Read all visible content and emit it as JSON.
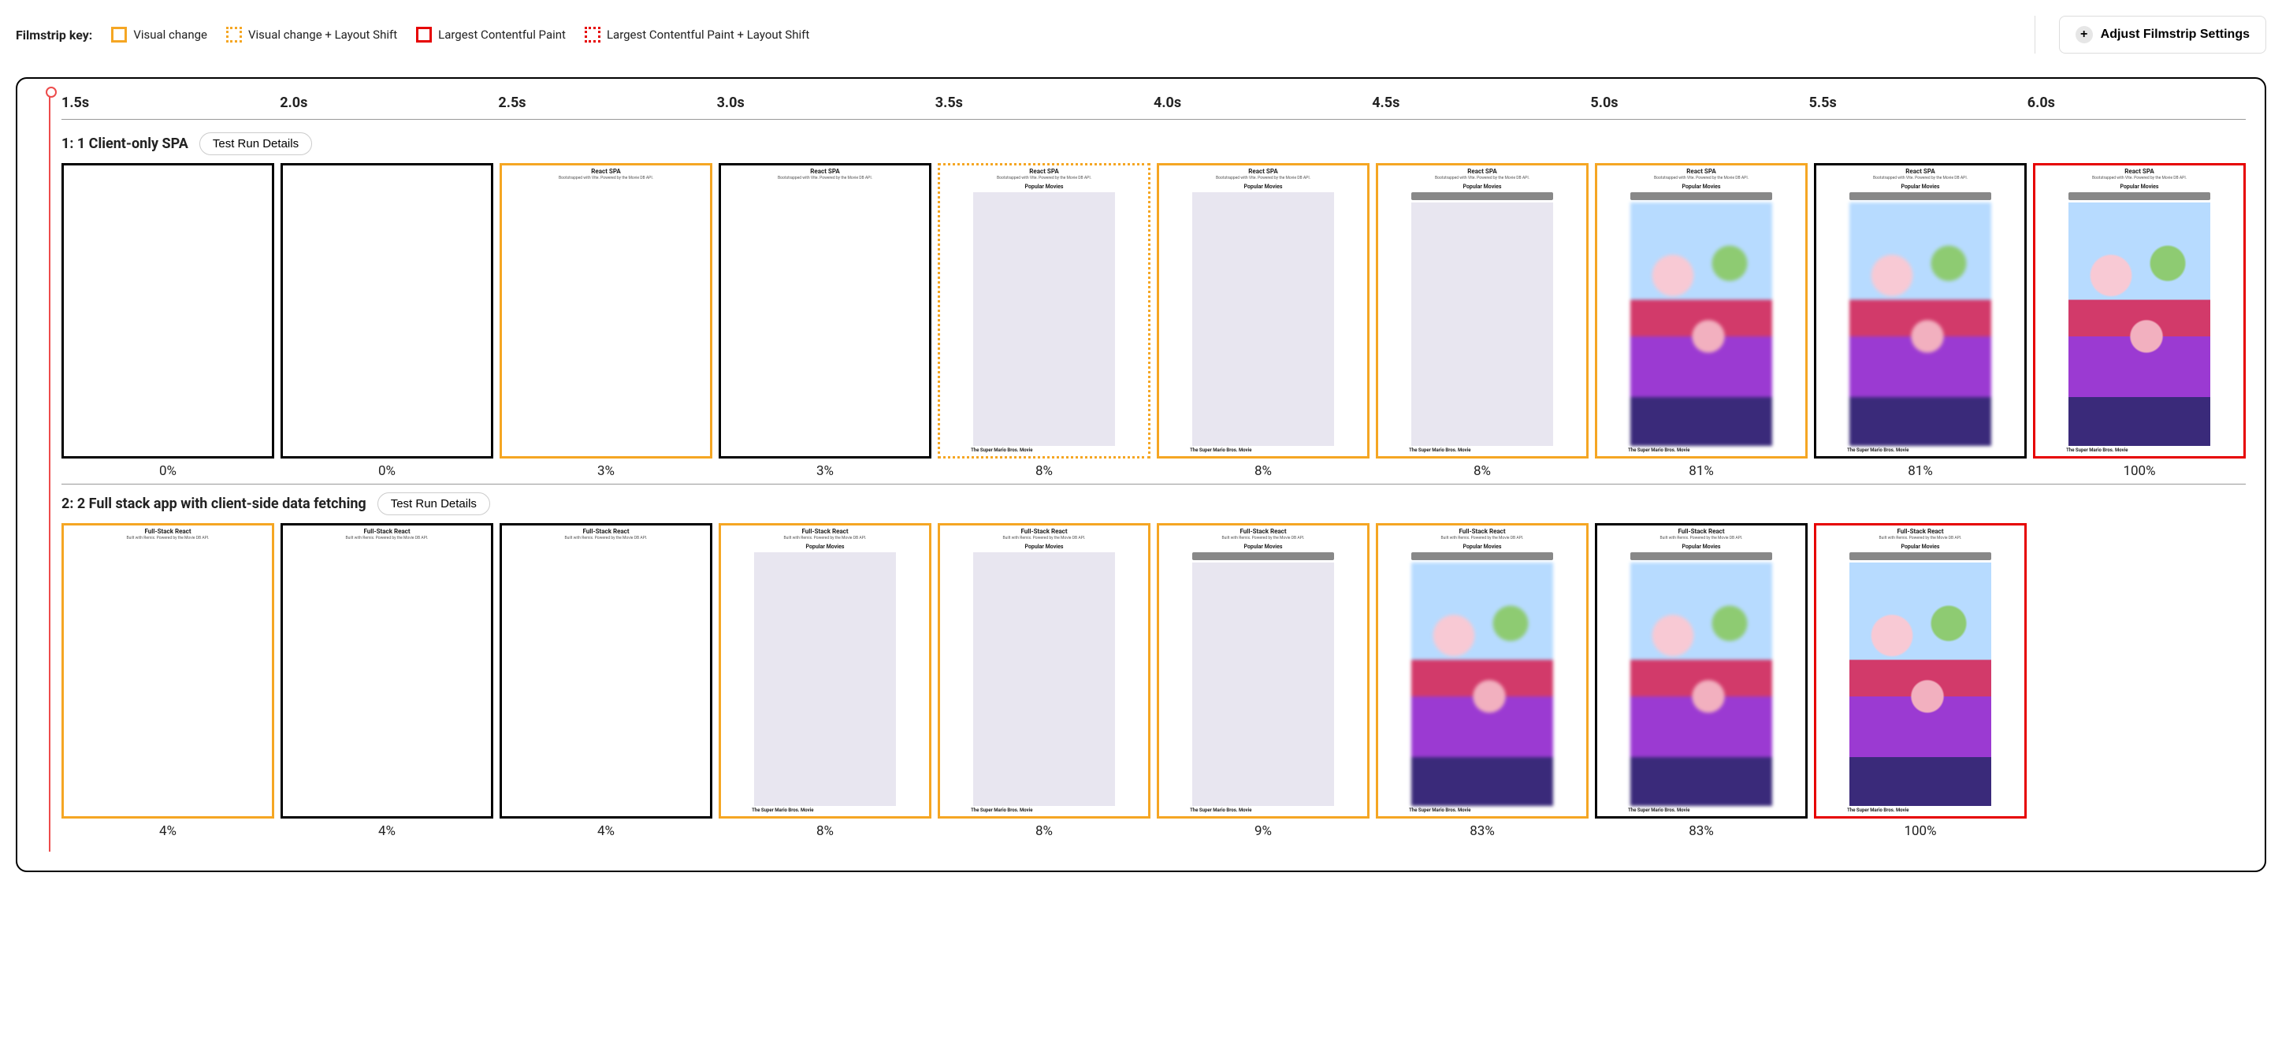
{
  "header": {
    "key_label": "Filmstrip key:",
    "legend": [
      {
        "swatch": "solid-orange",
        "label": "Visual change"
      },
      {
        "swatch": "dashed-orange",
        "label": "Visual change + Layout Shift"
      },
      {
        "swatch": "solid-red",
        "label": "Largest Contentful Paint"
      },
      {
        "swatch": "dashed-red",
        "label": "Largest Contentful Paint + Layout Shift"
      }
    ],
    "settings_button": "Adjust Filmstrip Settings"
  },
  "timestamps": [
    "1.5s",
    "2.0s",
    "2.5s",
    "3.0s",
    "3.5s",
    "4.0s",
    "4.5s",
    "5.0s",
    "5.5s",
    "6.0s"
  ],
  "rows": [
    {
      "title": "1: 1 Client-only SPA",
      "details_button": "Test Run Details",
      "app_title": "React SPA",
      "app_tagline": "Bootstrapped with Vite. Powered by the Movie DB API.",
      "app_heading": "Popular Movies",
      "movie_caption": "The Super Mario Bros. Movie",
      "frames": [
        {
          "border": "black",
          "dashed": false,
          "percent": "0%",
          "content": "blank"
        },
        {
          "border": "black",
          "dashed": false,
          "percent": "0%",
          "content": "blank"
        },
        {
          "border": "orange",
          "dashed": false,
          "percent": "3%",
          "content": "header"
        },
        {
          "border": "black",
          "dashed": false,
          "percent": "3%",
          "content": "header"
        },
        {
          "border": "orange",
          "dashed": true,
          "percent": "8%",
          "content": "placeholder"
        },
        {
          "border": "orange",
          "dashed": false,
          "percent": "8%",
          "content": "placeholder"
        },
        {
          "border": "orange",
          "dashed": false,
          "percent": "8%",
          "content": "badge"
        },
        {
          "border": "orange",
          "dashed": false,
          "percent": "81%",
          "content": "poster-blur"
        },
        {
          "border": "black",
          "dashed": false,
          "percent": "81%",
          "content": "poster-blur"
        },
        {
          "border": "red",
          "dashed": false,
          "percent": "100%",
          "content": "poster"
        }
      ]
    },
    {
      "title": "2: 2 Full stack app with client-side data fetching",
      "details_button": "Test Run Details",
      "app_title": "Full-Stack React",
      "app_tagline": "Built with Remix. Powered by the Movie DB API.",
      "app_heading": "Popular Movies",
      "movie_caption": "The Super Mario Bros. Movie",
      "frames": [
        {
          "border": "orange",
          "dashed": false,
          "percent": "4%",
          "content": "header"
        },
        {
          "border": "black",
          "dashed": false,
          "percent": "4%",
          "content": "header"
        },
        {
          "border": "black",
          "dashed": false,
          "percent": "4%",
          "content": "header"
        },
        {
          "border": "orange",
          "dashed": false,
          "percent": "8%",
          "content": "placeholder"
        },
        {
          "border": "orange",
          "dashed": false,
          "percent": "8%",
          "content": "placeholder"
        },
        {
          "border": "orange",
          "dashed": false,
          "percent": "9%",
          "content": "badge-caption"
        },
        {
          "border": "orange",
          "dashed": false,
          "percent": "83%",
          "content": "poster-blur"
        },
        {
          "border": "black",
          "dashed": false,
          "percent": "83%",
          "content": "poster-blur"
        },
        {
          "border": "red",
          "dashed": false,
          "percent": "100%",
          "content": "poster"
        }
      ]
    }
  ]
}
